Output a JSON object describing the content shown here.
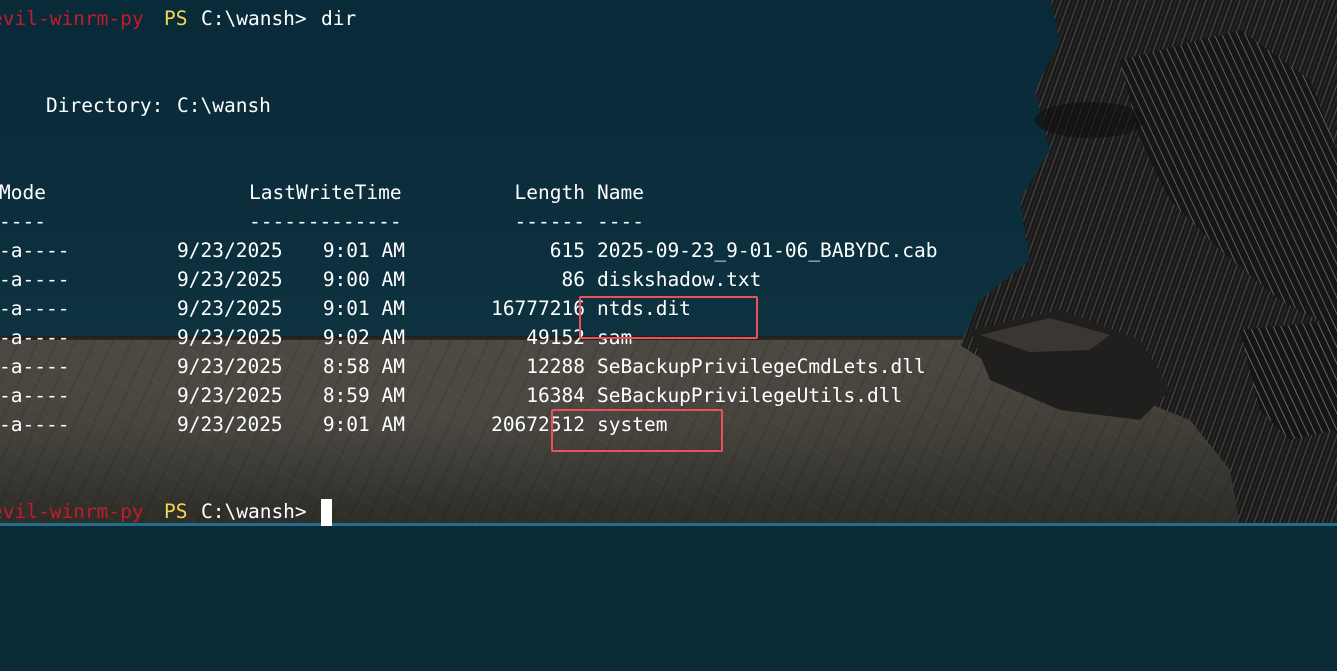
{
  "terminal": {
    "prompt_name": "evil-winrm-py",
    "prompt_ps": "PS",
    "prompt_path": "C:\\wansh>",
    "command": "dir",
    "directory_label": "Directory:",
    "directory_path": "C:\\wansh",
    "headers": {
      "mode": "Mode",
      "lastwrite": "LastWriteTime",
      "length": "Length",
      "name": "Name"
    },
    "separators": {
      "mode": "----",
      "lastwrite": "-------------",
      "length": "------",
      "name": "----"
    },
    "rows": [
      {
        "mode": "-a----",
        "date": "9/23/2025",
        "time": "9:01 AM",
        "length": "615",
        "name": "2025-09-23_9-01-06_BABYDC.cab"
      },
      {
        "mode": "-a----",
        "date": "9/23/2025",
        "time": "9:00 AM",
        "length": "86",
        "name": "diskshadow.txt"
      },
      {
        "mode": "-a----",
        "date": "9/23/2025",
        "time": "9:01 AM",
        "length": "16777216",
        "name": "ntds.dit"
      },
      {
        "mode": "-a----",
        "date": "9/23/2025",
        "time": "9:02 AM",
        "length": "49152",
        "name": "sam"
      },
      {
        "mode": "-a----",
        "date": "9/23/2025",
        "time": "8:58 AM",
        "length": "12288",
        "name": "SeBackupPrivilegeCmdLets.dll"
      },
      {
        "mode": "-a----",
        "date": "9/23/2025",
        "time": "8:59 AM",
        "length": "16384",
        "name": "SeBackupPrivilegeUtils.dll"
      },
      {
        "mode": "-a----",
        "date": "9/23/2025",
        "time": "9:01 AM",
        "length": "20672512",
        "name": "system"
      }
    ],
    "highlighted_files": [
      "ntds.dit",
      "system"
    ]
  },
  "colors": {
    "background": "#0a2a38",
    "prompt_name": "#c21b2c",
    "prompt_ps": "#f3d74e",
    "text": "#ffffff",
    "highlight_box": "#e8525a"
  }
}
